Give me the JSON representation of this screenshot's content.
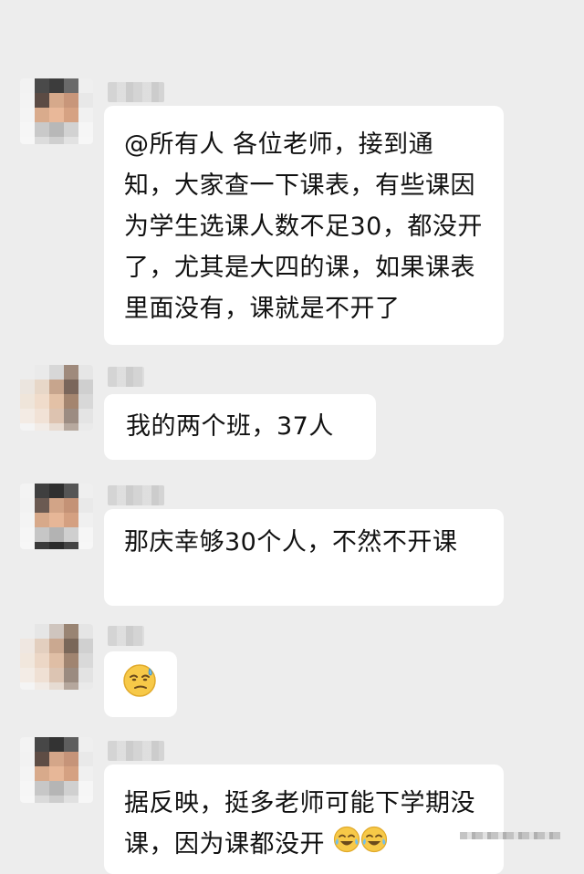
{
  "messages": [
    {
      "text": "@所有人  各位老师，接到通知，大家查一下课表，有些课因为学生选课人数不足30，都没开了，尤其是大四的课，如果课表里面没有，课就是不开了"
    },
    {
      "text": "我的两个班，37人"
    },
    {
      "text": "那庆幸够30个人，不然不开课"
    },
    {
      "text": "",
      "emoji": "smirking-sweat-face-emoji"
    },
    {
      "text": "据反映，挺多老师可能下学期没课，因为课都没开",
      "trailing_emojis": [
        "crying-laughing-emoji",
        "crying-laughing-emoji"
      ]
    }
  ],
  "colors": {
    "background": "#ededed",
    "bubble": "#ffffff",
    "text": "#111111",
    "emoji_yellow": "#f7c948"
  }
}
